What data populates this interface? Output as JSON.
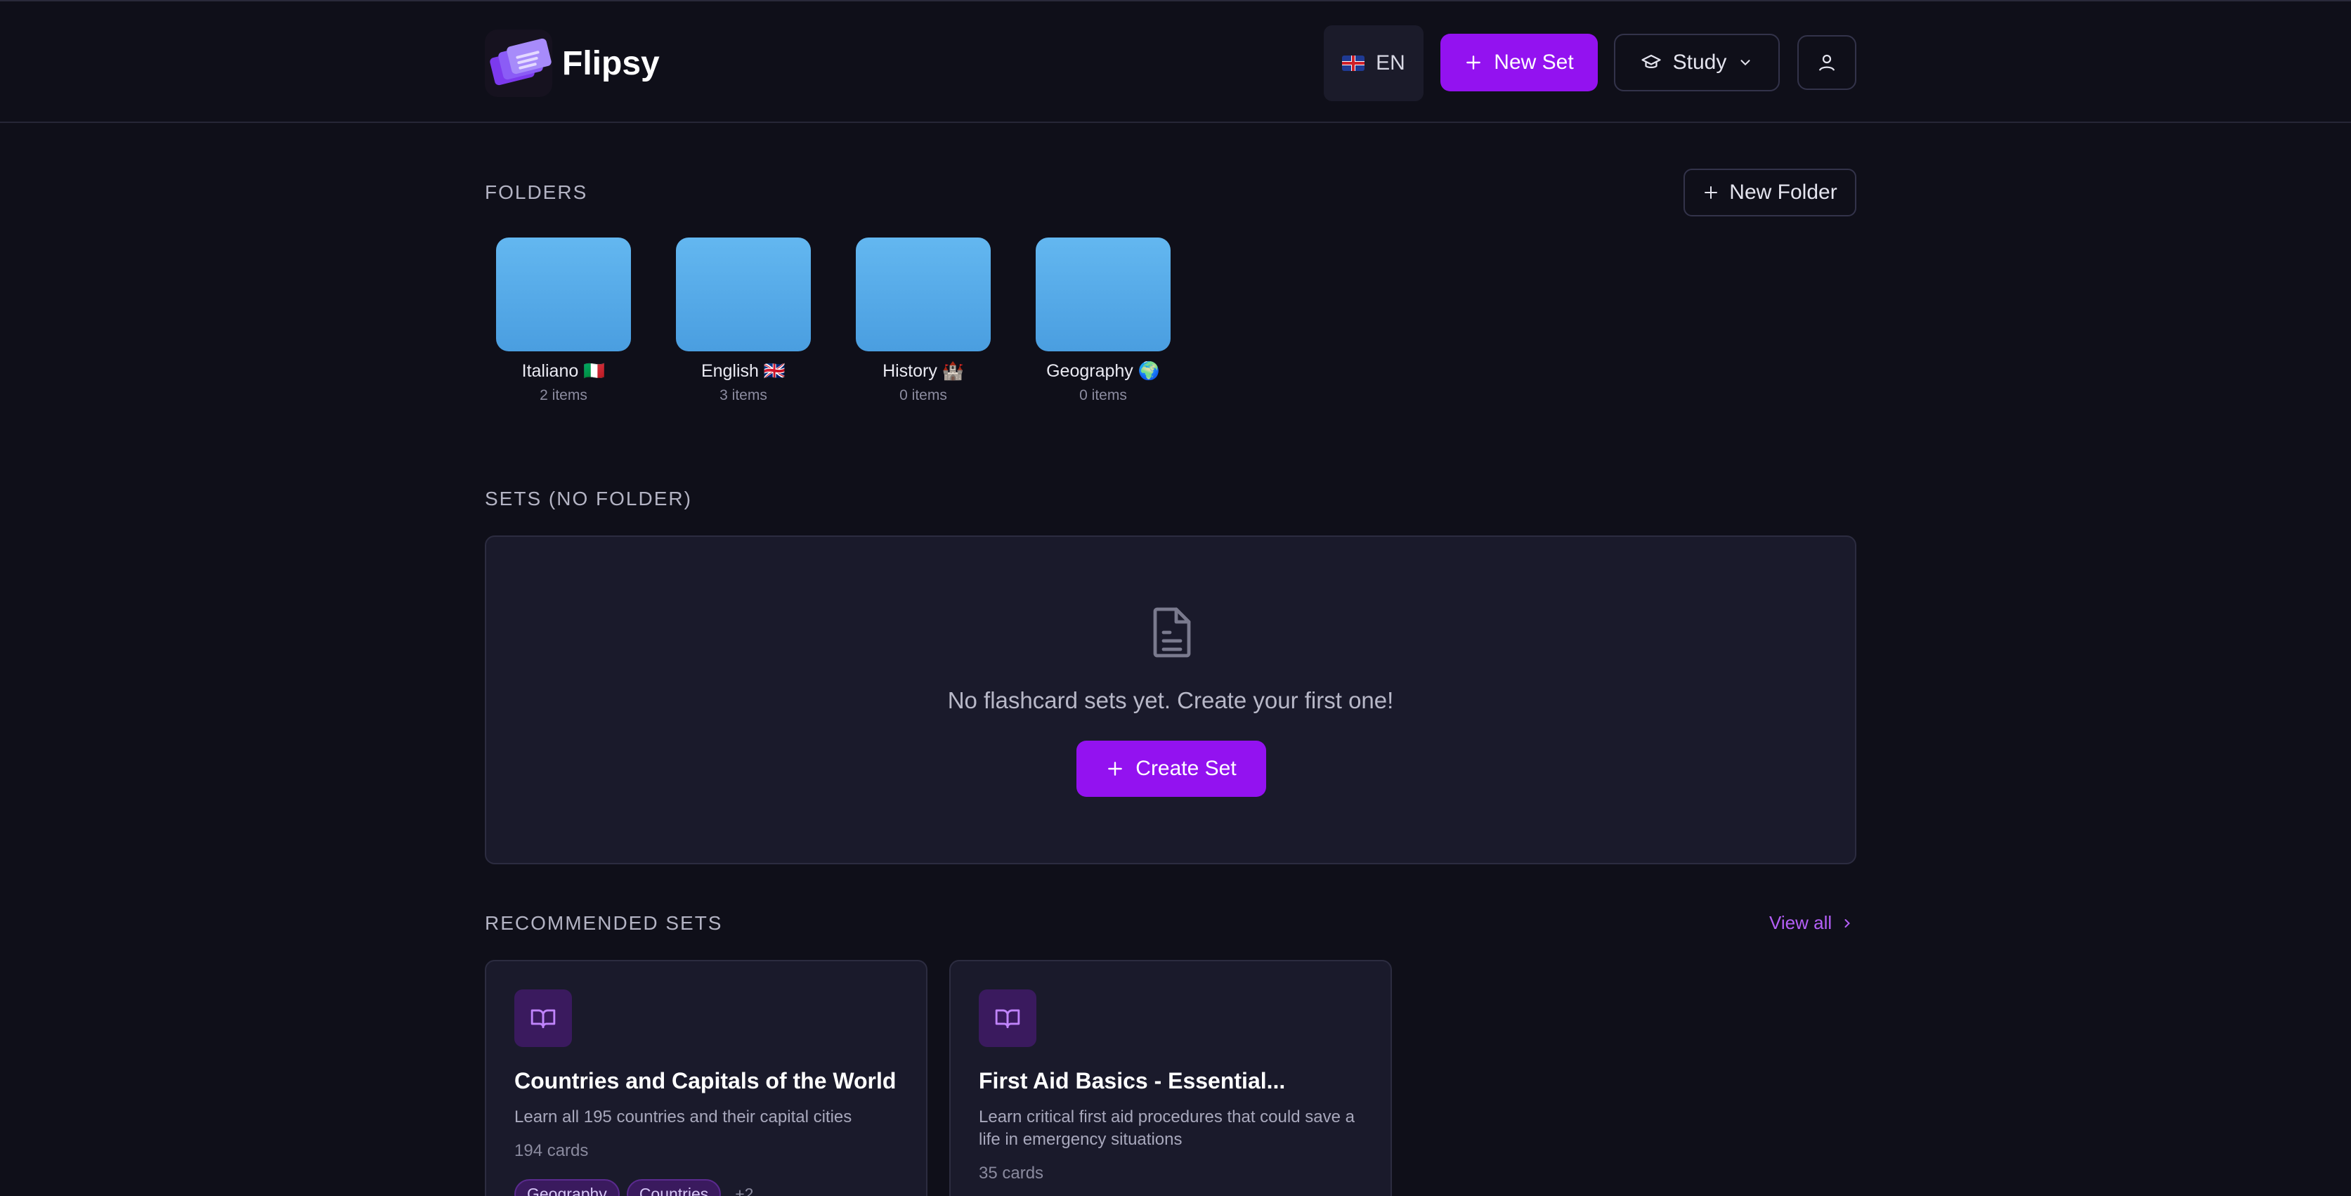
{
  "header": {
    "app_name": "Flipsy",
    "language_label": "EN",
    "new_set_label": "New Set",
    "study_label": "Study"
  },
  "folders_section": {
    "title": "FOLDERS",
    "new_folder_label": "New Folder",
    "items": [
      {
        "name": "Italiano 🇮🇹",
        "count": "2 items"
      },
      {
        "name": "English 🇬🇧",
        "count": "3 items"
      },
      {
        "name": "History 🏰",
        "count": "0 items"
      },
      {
        "name": "Geography 🌍",
        "count": "0 items"
      }
    ]
  },
  "sets_section": {
    "title": "SETS (NO FOLDER)",
    "empty_message": "No flashcard sets yet. Create your first one!",
    "create_label": "Create Set"
  },
  "recommended_section": {
    "title": "RECOMMENDED SETS",
    "view_all_label": "View all",
    "cards": [
      {
        "title": "Countries and Capitals of the World",
        "description": "Learn all 195 countries and their capital cities",
        "count": "194 cards",
        "tags": [
          "Geography",
          "Countries"
        ],
        "more": "+2"
      },
      {
        "title": "First Aid Basics - Essential...",
        "description": "Learn critical first aid procedures that could save a life in emergency situations",
        "count": "35 cards"
      }
    ]
  },
  "colors": {
    "background": "#0f0f19",
    "accent": "#9312f0",
    "folder": "#5aaeea",
    "link": "#b45ff7"
  }
}
